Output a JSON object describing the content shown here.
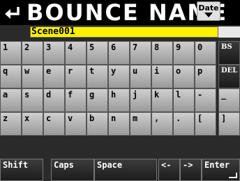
{
  "header": {
    "title": "BOUNCE NAME",
    "date_button_label": "Date"
  },
  "name_field": {
    "value": "Scene001"
  },
  "keyboard": {
    "rows": [
      [
        "1",
        "2",
        "3",
        "4",
        "5",
        "6",
        "7",
        "8",
        "9",
        "0",
        "BS"
      ],
      [
        "q",
        "w",
        "e",
        "r",
        "t",
        "y",
        "u",
        "i",
        "o",
        "p",
        "DEL"
      ],
      [
        "a",
        "s",
        "d",
        "f",
        "g",
        "h",
        "j",
        "k",
        "l",
        "-",
        "_"
      ],
      [
        "z",
        "x",
        "c",
        "v",
        "b",
        "n",
        "m",
        ",",
        ".",
        "[",
        "]"
      ]
    ],
    "function_keys": {
      "shift": "Shift",
      "caps": "Caps",
      "space": "Space",
      "left": "<-",
      "right": "->",
      "enter": "Enter"
    }
  },
  "colors": {
    "title_bg": "#000000",
    "name_field_bg": "#fff200",
    "key_light": "#c0c0c0",
    "key_dark": "#2a2a2a"
  },
  "icons": {
    "back": "return-arrow-icon",
    "date_sort": "triangle-down-icon"
  }
}
